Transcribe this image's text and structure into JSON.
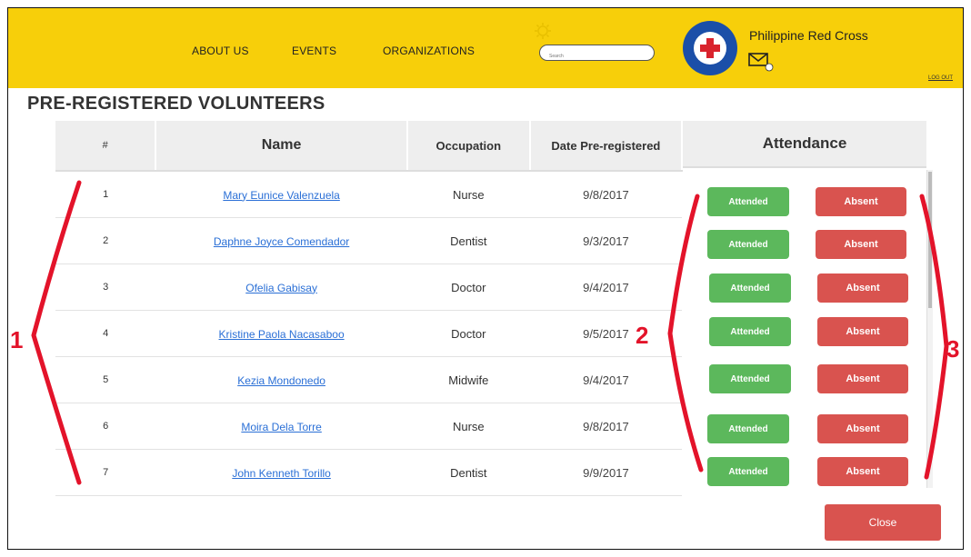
{
  "nav": {
    "items": [
      "ABOUT US",
      "EVENTS",
      "ORGANIZATIONS"
    ]
  },
  "search": {
    "placeholder": "Search"
  },
  "brand": {
    "name": "Philippine Red Cross",
    "logout": "LOG OUT"
  },
  "page": {
    "title": "PRE-REGISTERED VOLUNTEERS"
  },
  "table": {
    "headers": [
      "#",
      "Name",
      "Occupation",
      "Date Pre-registered",
      "Attendance"
    ],
    "rows": [
      {
        "num": "1",
        "name": "Mary Eunice Valenzuela",
        "occupation": "Nurse",
        "date": "9/8/2017"
      },
      {
        "num": "2",
        "name": "Daphne Joyce Comendador",
        "occupation": "Dentist",
        "date": "9/3/2017"
      },
      {
        "num": "3",
        "name": "Ofelia Gabisay",
        "occupation": "Doctor",
        "date": "9/4/2017"
      },
      {
        "num": "4",
        "name": "Kristine Paola Nacasaboo",
        "occupation": "Doctor",
        "date": "9/5/2017"
      },
      {
        "num": "5",
        "name": "Kezia Mondonedo",
        "occupation": "Midwife",
        "date": "9/4/2017"
      },
      {
        "num": "6",
        "name": "Moira Dela Torre",
        "occupation": "Nurse",
        "date": "9/8/2017"
      },
      {
        "num": "7",
        "name": "John Kenneth Torillo",
        "occupation": "Dentist",
        "date": "9/9/2017"
      }
    ],
    "attended_label": "Attended",
    "absent_label": "Absent"
  },
  "close_label": "Close",
  "annotations": [
    "1",
    "2",
    "3"
  ],
  "colors": {
    "header": "#f7cf0a",
    "attended": "#5cb85c",
    "absent": "#d9534f",
    "annotation": "#e3132a",
    "link": "#2a6fd6"
  }
}
